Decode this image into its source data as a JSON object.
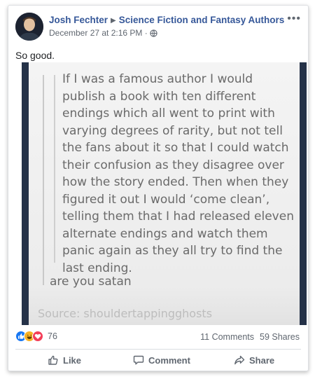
{
  "post": {
    "author": "Josh Fechter",
    "group": "Science Fiction and Fantasy Authors",
    "timestamp": "December 27 at 2:16 PM",
    "privacy_icon": "globe-icon",
    "text": "So good."
  },
  "image": {
    "quote": "If I was a famous author I would publish a book with ten different endings which all went to print with varying degrees of rarity, but not tell the fans about it so that I could watch their confusion as they disagree over how the story ended. Then when they figured it out I would ‘come clean’, telling them that I had released eleven alternate endings and watch them panic again as they all try to find the last ending.",
    "reply": "are you satan",
    "source": "Source: shouldertappingghosts"
  },
  "stats": {
    "reactions_count": "76",
    "comments": "11 Comments",
    "shares": "59 Shares",
    "reaction_icons": [
      "like-icon",
      "haha-icon",
      "love-icon"
    ]
  },
  "actions": {
    "like": "Like",
    "comment": "Comment",
    "share": "Share"
  },
  "colors": {
    "link": "#365899",
    "like_blue": "#1877f2",
    "haha_yellow": "#f7b125",
    "love_red": "#f33e58",
    "image_frame": "#253248"
  }
}
